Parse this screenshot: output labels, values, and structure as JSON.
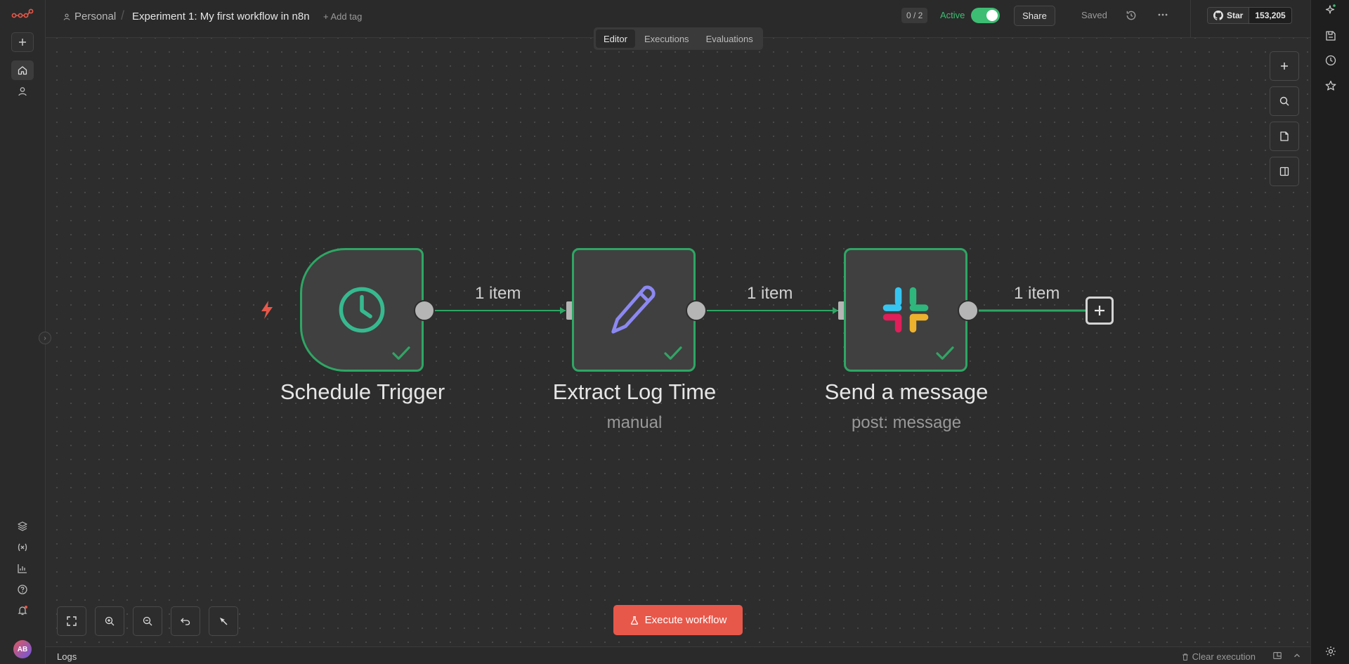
{
  "header": {
    "breadcrumb_project": "Personal",
    "breadcrumb_separator": "/",
    "workflow_title": "Experiment 1: My first workflow in n8n",
    "add_tag": "+ Add tag",
    "counter": "0 / 2",
    "active_label": "Active",
    "active": true,
    "share_label": "Share",
    "saved_label": "Saved",
    "github_star": "Star",
    "github_count": "153,205"
  },
  "tabs": [
    {
      "label": "Editor",
      "active": true
    },
    {
      "label": "Executions",
      "active": false
    },
    {
      "label": "Evaluations",
      "active": false
    }
  ],
  "nodes": [
    {
      "title": "Schedule Trigger",
      "subtitle": "",
      "icon": "clock-icon",
      "status": "success"
    },
    {
      "title": "Extract Log Time",
      "subtitle": "manual",
      "icon": "pencil-icon",
      "status": "success"
    },
    {
      "title": "Send a message",
      "subtitle": "post: message",
      "icon": "slack-icon",
      "status": "success"
    }
  ],
  "edges": [
    {
      "label": "1 item"
    },
    {
      "label": "1 item"
    },
    {
      "label": "1 item"
    }
  ],
  "execute_button": "Execute workflow",
  "avatar_initials": "AB",
  "logs": {
    "label": "Logs",
    "clear_execution": "Clear execution"
  },
  "colors": {
    "accent": "#e8584a",
    "success": "#2ea664",
    "canvas": "#2d2d2d"
  }
}
